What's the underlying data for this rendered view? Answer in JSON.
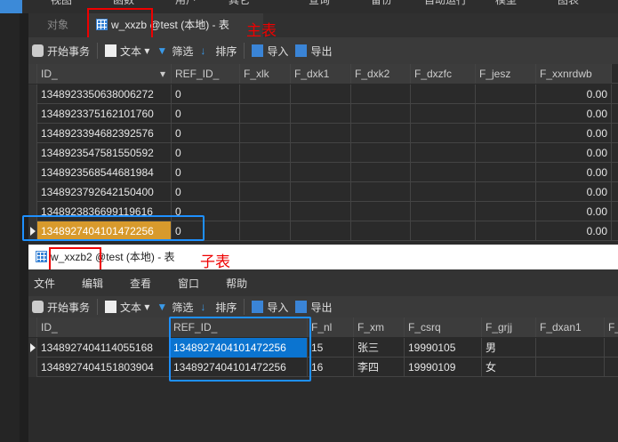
{
  "top_menu": [
    "视图",
    "函数",
    "用户",
    "其它",
    "查询",
    "备份",
    "自动运行",
    "模型",
    "图表"
  ],
  "main_tabs": {
    "objects": "对象",
    "active": "w_xxzb @test (本地) - 表"
  },
  "annotations": {
    "main": "主表",
    "child": "子表"
  },
  "toolbar": {
    "begin_tx": "开始事务",
    "text": "文本",
    "filter": "筛选",
    "sort": "排序",
    "import": "导入",
    "export": "导出"
  },
  "main_table": {
    "columns": [
      "ID_",
      "REF_ID_",
      "F_xlk",
      "F_dxk1",
      "F_dxk2",
      "F_dxzfc",
      "F_jesz",
      "F_xxnrdwb"
    ],
    "rows": [
      [
        "1348923350638006272",
        "0",
        "",
        "",
        "",
        "",
        "",
        "0.00"
      ],
      [
        "1348923375162101760",
        "0",
        "",
        "",
        "",
        "",
        "",
        "0.00"
      ],
      [
        "1348923394682392576",
        "0",
        "",
        "",
        "",
        "",
        "",
        "0.00"
      ],
      [
        "1348923547581550592",
        "0",
        "",
        "",
        "",
        "",
        "",
        "0.00"
      ],
      [
        "1348923568544681984",
        "0",
        "",
        "",
        "",
        "",
        "",
        "0.00"
      ],
      [
        "1348923792642150400",
        "0",
        "",
        "",
        "",
        "",
        "",
        "0.00"
      ],
      [
        "1348923836699119616",
        "0",
        "",
        "",
        "",
        "",
        "",
        "0.00"
      ],
      [
        "1348927404101472256",
        "0",
        "",
        "",
        "",
        "",
        "",
        "0.00"
      ]
    ]
  },
  "child_window": {
    "title": "w_xxzb2 @test (本地) - 表",
    "menu": [
      "文件",
      "编辑",
      "查看",
      "窗口",
      "帮助"
    ]
  },
  "child_table": {
    "columns": [
      "ID_",
      "REF_ID_",
      "F_nl",
      "F_xm",
      "F_csrq",
      "F_grjj",
      "F_dxan1",
      "F_"
    ],
    "rows": [
      [
        "1348927404114055168",
        "1348927404101472256",
        "15",
        "张三",
        "19990105",
        "男",
        "",
        ""
      ],
      [
        "1348927404151803904",
        "1348927404101472256",
        "16",
        "李四",
        "19990109",
        "女",
        "",
        ""
      ]
    ]
  }
}
